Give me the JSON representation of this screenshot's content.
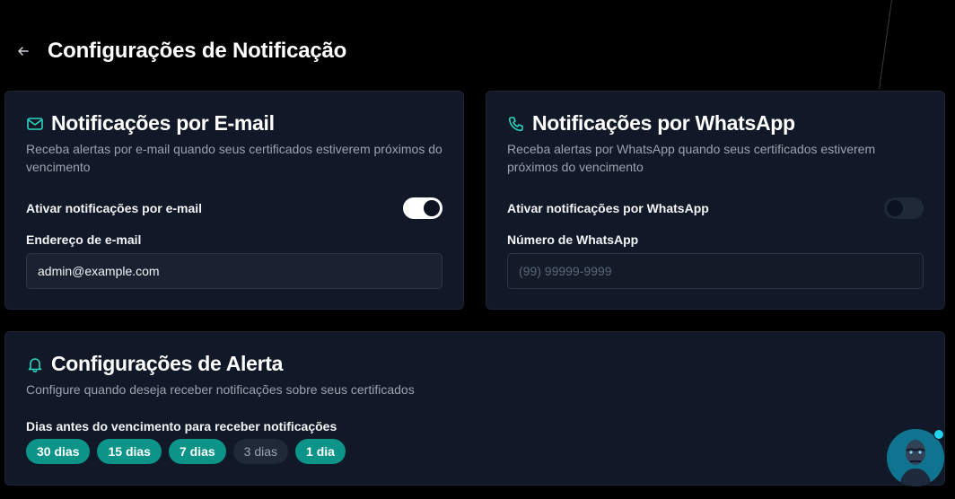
{
  "header": {
    "title": "Configurações de Notificação"
  },
  "email_card": {
    "title": "Notificações por E-mail",
    "description": "Receba alertas por e-mail quando seus certificados estiverem próximos do vencimento",
    "toggle_label": "Ativar notificações por e-mail",
    "toggle_on": true,
    "field_label": "Endereço de e-mail",
    "field_value": "admin@example.com"
  },
  "whatsapp_card": {
    "title": "Notificações por WhatsApp",
    "description": "Receba alertas por WhatsApp quando seus certificados estiverem próximos do vencimento",
    "toggle_label": "Ativar notificações por WhatsApp",
    "toggle_on": false,
    "field_label": "Número de WhatsApp",
    "field_placeholder": "(99) 99999-9999"
  },
  "alert_card": {
    "title": "Configurações de Alerta",
    "description": "Configure quando deseja receber notificações sobre seus certificados",
    "days_label": "Dias antes do vencimento para receber notificações",
    "options": [
      {
        "label": "30 dias",
        "selected": true
      },
      {
        "label": "15 dias",
        "selected": true
      },
      {
        "label": "7 dias",
        "selected": true
      },
      {
        "label": "3 dias",
        "selected": false
      },
      {
        "label": "1 dia",
        "selected": true
      }
    ]
  },
  "colors": {
    "accent": "#2dd4bf",
    "chip_active": "#0d9488",
    "card_bg": "#111827",
    "page_bg": "#000000"
  },
  "icons": {
    "back": "arrow-left-icon",
    "email": "mail-icon",
    "whatsapp": "phone-icon",
    "alert": "bell-icon",
    "assistant": "robot-avatar-icon"
  }
}
